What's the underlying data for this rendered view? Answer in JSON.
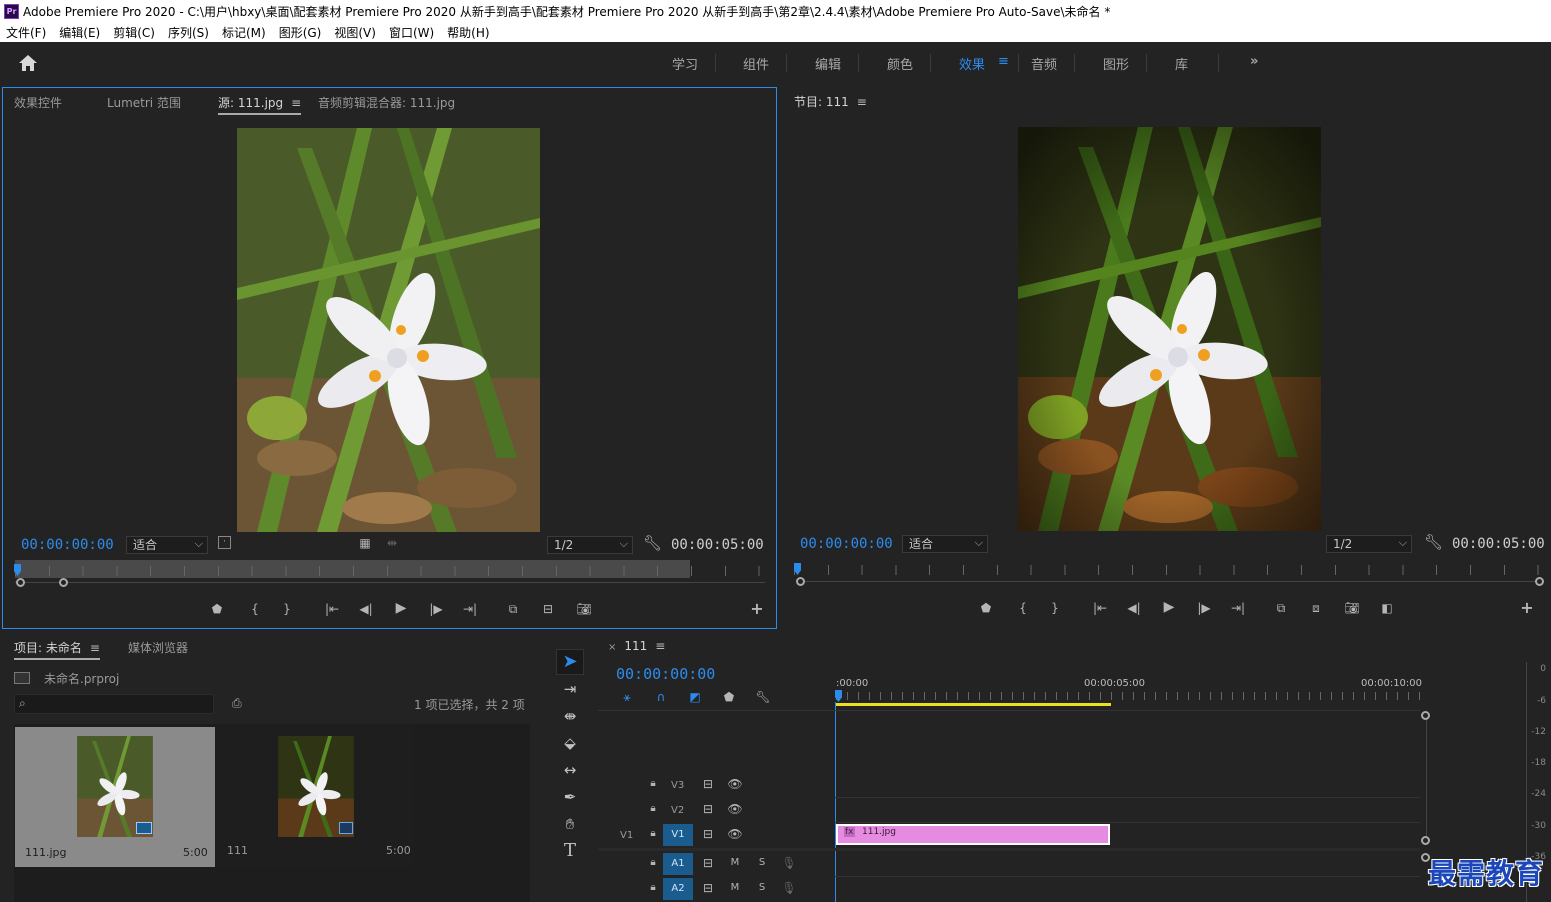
{
  "window": {
    "title": "Adobe Premiere Pro 2020 - C:\\用户\\hbxy\\桌面\\配套素材 Premiere Pro 2020 从新手到高手\\配套素材 Premiere Pro 2020 从新手到高手\\第2章\\2.4.4\\素材\\Adobe Premiere Pro Auto-Save\\未命名 *",
    "app_icon_text": "Pr"
  },
  "menu": [
    "文件(F)",
    "编辑(E)",
    "剪辑(C)",
    "序列(S)",
    "标记(M)",
    "图形(G)",
    "视图(V)",
    "窗口(W)",
    "帮助(H)"
  ],
  "workspaces": {
    "tabs": [
      "学习",
      "组件",
      "编辑",
      "颜色",
      "效果",
      "音频",
      "图形",
      "库"
    ],
    "active": "效果",
    "overflow": "»"
  },
  "source_panel": {
    "tabs": [
      "效果控件",
      "Lumetri 范围",
      "源: 111.jpg",
      "音频剪辑混合器: 111.jpg"
    ],
    "active_tab": "源: 111.jpg",
    "timecode_in": "00:00:00:00",
    "fit": "适合",
    "resolution": "1/2",
    "timecode_out": "00:00:05:00"
  },
  "program_panel": {
    "title": "节目: 111",
    "timecode_in": "00:00:00:00",
    "fit": "适合",
    "resolution": "1/2",
    "timecode_out": "00:00:05:00"
  },
  "project_panel": {
    "tabs": [
      "项目: 未命名",
      "媒体浏览器"
    ],
    "project_file": "未命名.prproj",
    "search_placeholder": "",
    "selection_info": "1 项已选择，共 2 项",
    "items": [
      {
        "name": "111.jpg",
        "duration": "5:00",
        "selected": true
      },
      {
        "name": "111",
        "duration": "5:00",
        "selected": false
      }
    ]
  },
  "timeline": {
    "sequence_name": "111",
    "timecode": "00:00:00:00",
    "ruler_labels": [
      ":00:00",
      "00:00:05:00",
      "00:00:10:00"
    ],
    "tracks": [
      {
        "name": "V3",
        "type": "video"
      },
      {
        "name": "V2",
        "type": "video"
      },
      {
        "name": "V1",
        "type": "video",
        "source": "V1"
      },
      {
        "name": "A1",
        "type": "audio"
      },
      {
        "name": "A2",
        "type": "audio"
      }
    ],
    "clip": {
      "name": "111.jpg",
      "track": "V1",
      "color": "#e58be0"
    },
    "mute_label": "M",
    "solo_label": "S"
  },
  "audio_meter": {
    "scale": [
      "0",
      "-6",
      "-12",
      "-18",
      "-24",
      "-30",
      "-36"
    ]
  },
  "watermark": "最需教育",
  "colors": {
    "accent": "#2d8ceb",
    "clip": "#e58be0",
    "in_out_bar": "#e8e020"
  }
}
